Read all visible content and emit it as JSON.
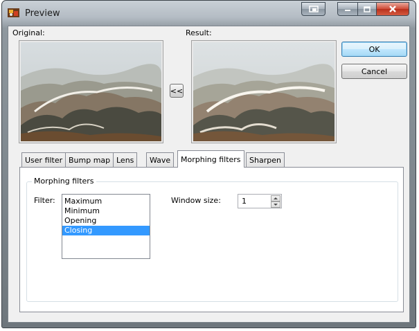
{
  "window": {
    "title": "Preview"
  },
  "images": {
    "original_label": "Original:",
    "result_label": "Result:",
    "copy_button": "<<"
  },
  "buttons": {
    "ok": "OK",
    "cancel": "Cancel"
  },
  "tabs": [
    {
      "label": "User filter",
      "active": false
    },
    {
      "label": "Bump map",
      "active": false
    },
    {
      "label": "Lens",
      "active": false
    },
    {
      "label": "Wave",
      "active": false
    },
    {
      "label": "Morphing filters",
      "active": true
    },
    {
      "label": "Sharpen",
      "active": false
    }
  ],
  "morphing": {
    "group_title": "Morphing filters",
    "filter_label": "Filter:",
    "filter_options": [
      "Maximum",
      "Minimum",
      "Opening",
      "Closing"
    ],
    "selected_filter": "Closing",
    "window_size_label": "Window size:",
    "window_size_value": "1"
  },
  "colors": {
    "selection": "#3399ff",
    "close_button": "#c8402c"
  }
}
